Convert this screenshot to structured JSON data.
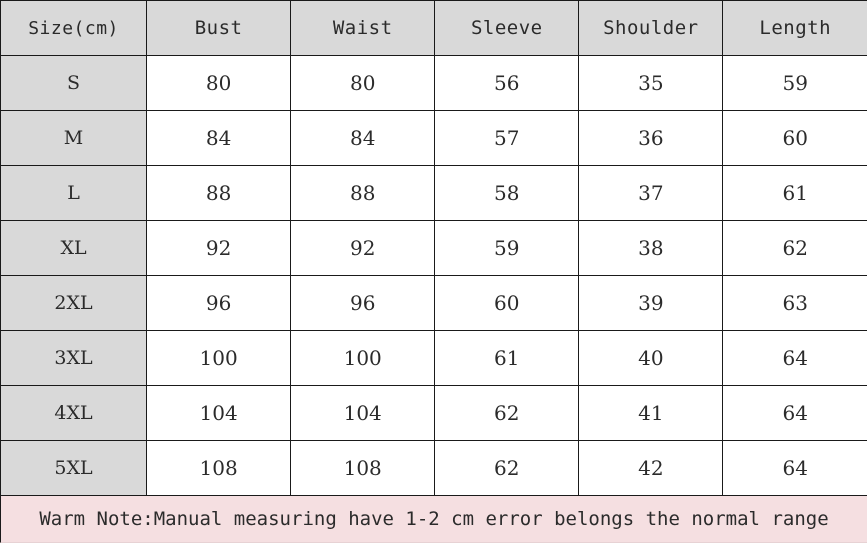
{
  "table": {
    "headers": [
      "Size(cm)",
      "Bust",
      "Waist",
      "Sleeve",
      "Shoulder",
      "Length"
    ],
    "rows": [
      {
        "size": "S",
        "bust": "80",
        "waist": "80",
        "sleeve": "56",
        "shoulder": "35",
        "length": "59"
      },
      {
        "size": "M",
        "bust": "84",
        "waist": "84",
        "sleeve": "57",
        "shoulder": "36",
        "length": "60"
      },
      {
        "size": "L",
        "bust": "88",
        "waist": "88",
        "sleeve": "58",
        "shoulder": "37",
        "length": "61"
      },
      {
        "size": "XL",
        "bust": "92",
        "waist": "92",
        "sleeve": "59",
        "shoulder": "38",
        "length": "62"
      },
      {
        "size": "2XL",
        "bust": "96",
        "waist": "96",
        "sleeve": "60",
        "shoulder": "39",
        "length": "63"
      },
      {
        "size": "3XL",
        "bust": "100",
        "waist": "100",
        "sleeve": "61",
        "shoulder": "40",
        "length": "64"
      },
      {
        "size": "4XL",
        "bust": "104",
        "waist": "104",
        "sleeve": "62",
        "shoulder": "41",
        "length": "64"
      },
      {
        "size": "5XL",
        "bust": "108",
        "waist": "108",
        "sleeve": "62",
        "shoulder": "42",
        "length": "64"
      }
    ]
  },
  "footer": {
    "note": "Warm Note:Manual measuring have 1-2 cm error belongs the normal range"
  },
  "colors": {
    "header_background": "#d9d9d9",
    "size_column_background": "#d9d9d9",
    "cell_background": "#ffffff",
    "footer_background": "#f5dfe1",
    "border": "#1a1a1a",
    "text": "#2b2b2b"
  }
}
